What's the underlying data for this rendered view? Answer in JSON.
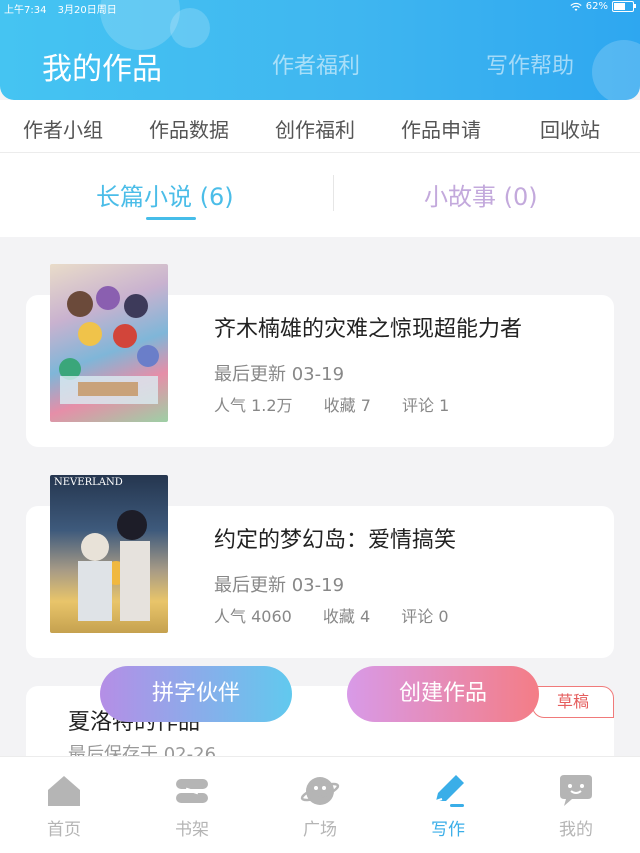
{
  "status_bar": {
    "time": "上午7:34",
    "date": "3月20日周日",
    "battery": "62%",
    "battery_level": 0.62
  },
  "header": {
    "tabs": [
      {
        "label": "我的作品",
        "active": true
      },
      {
        "label": "作者福利",
        "active": false
      },
      {
        "label": "写作帮助",
        "active": false
      }
    ]
  },
  "subnav": {
    "items": [
      "作者小组",
      "作品数据",
      "创作福利",
      "作品申请",
      "回收站"
    ]
  },
  "type_tabs": {
    "novel": "长篇小说 (6)",
    "story": "小故事 (0)"
  },
  "works": [
    {
      "title": "齐木楠雄的灾难之惊现超能力者",
      "updated": "最后更新 03-19",
      "popularity": "人气 1.2万",
      "favorites": "收藏 7",
      "comments": "评论 1"
    },
    {
      "cover_text": "NEVERLAND",
      "title": "约定的梦幻岛：爱情搞笑",
      "updated": "最后更新 03-19",
      "popularity": "人气 4060",
      "favorites": "收藏 4",
      "comments": "评论 0"
    },
    {
      "title": "夏洛特的作品",
      "updated": "最后保存于 02-26",
      "badge": "草稿"
    }
  ],
  "actions": {
    "partner": "拼字伙伴",
    "create": "创建作品"
  },
  "bottom_nav": [
    {
      "label": "首页",
      "icon": "home-icon",
      "active": false
    },
    {
      "label": "书架",
      "icon": "bookshelf-icon",
      "active": false
    },
    {
      "label": "广场",
      "icon": "planet-icon",
      "active": false
    },
    {
      "label": "写作",
      "icon": "pen-icon",
      "active": true
    },
    {
      "label": "我的",
      "icon": "chat-face-icon",
      "active": false
    }
  ],
  "colors": {
    "accent": "#3aaee8",
    "header_start": "#45c4f2",
    "header_end": "#2ea7f0",
    "draft": "#e55e5e"
  }
}
